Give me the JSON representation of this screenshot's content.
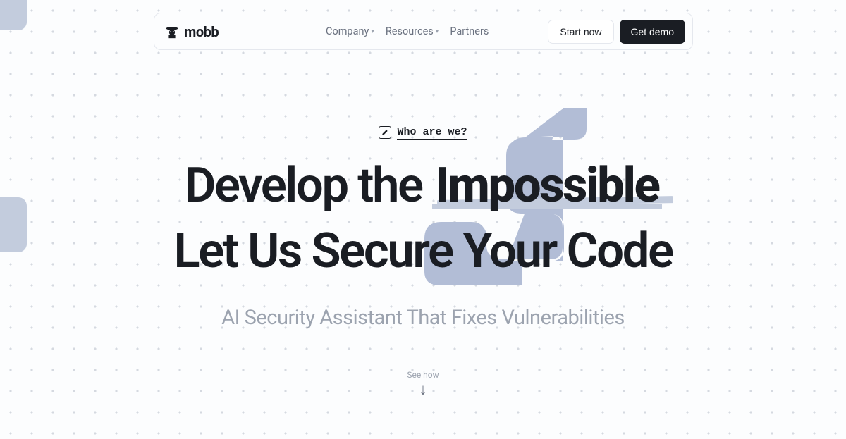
{
  "brand": {
    "name": "mobb"
  },
  "nav": {
    "links": [
      {
        "label": "Company",
        "hasDropdown": true
      },
      {
        "label": "Resources",
        "hasDropdown": true
      },
      {
        "label": "Partners",
        "hasDropdown": false
      }
    ],
    "cta_start": "Start now",
    "cta_demo": "Get demo"
  },
  "hero": {
    "eyebrow": "Who are we?",
    "title_prefix": "Develop the ",
    "title_emphasis": "Impossible",
    "title_line2": "Let Us Secure Your Code",
    "subtitle": "AI Security Assistant That Fixes Vulnerabilities",
    "scroll_cue": "See how"
  },
  "colors": {
    "text_primary": "#1a1d23",
    "text_muted": "#9ca3af",
    "accent_shape": "#b2bdd6",
    "dots": "#d5d9e0"
  }
}
